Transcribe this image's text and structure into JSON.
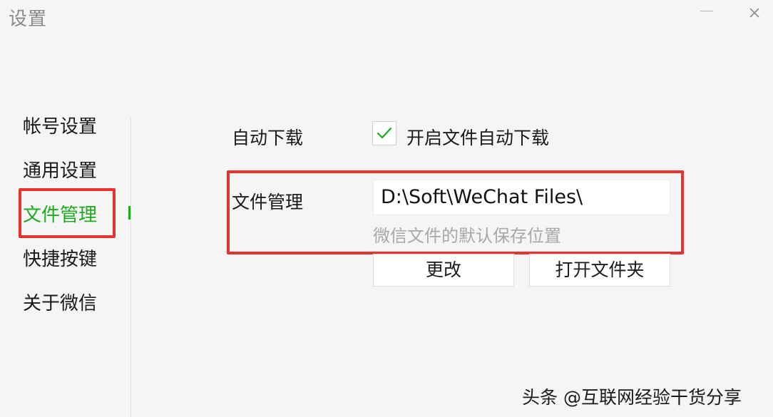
{
  "window": {
    "title": "设置",
    "controls": {
      "minimize_icon": "minimize-icon",
      "close_icon": "close-icon"
    }
  },
  "sidebar": {
    "items": [
      {
        "label": "帐号设置",
        "active": false
      },
      {
        "label": "通用设置",
        "active": false
      },
      {
        "label": "文件管理",
        "active": true
      },
      {
        "label": "快捷按键",
        "active": false
      },
      {
        "label": "关于微信",
        "active": false
      }
    ]
  },
  "auto_download": {
    "label": "自动下载",
    "checkbox_label": "开启文件自动下载",
    "checked": true
  },
  "file_management": {
    "label": "文件管理",
    "path_value": "D:\\Soft\\WeChat Files\\",
    "hint": "微信文件的默认保存位置",
    "change_button": "更改",
    "open_folder_button": "打开文件夹"
  },
  "watermark": "头条 @互联网经验干货分享",
  "colors": {
    "accent_green": "#1aad19",
    "highlight_red": "#e8322f",
    "background": "#f5f5f5",
    "hint_gray": "#a8a8a8"
  }
}
